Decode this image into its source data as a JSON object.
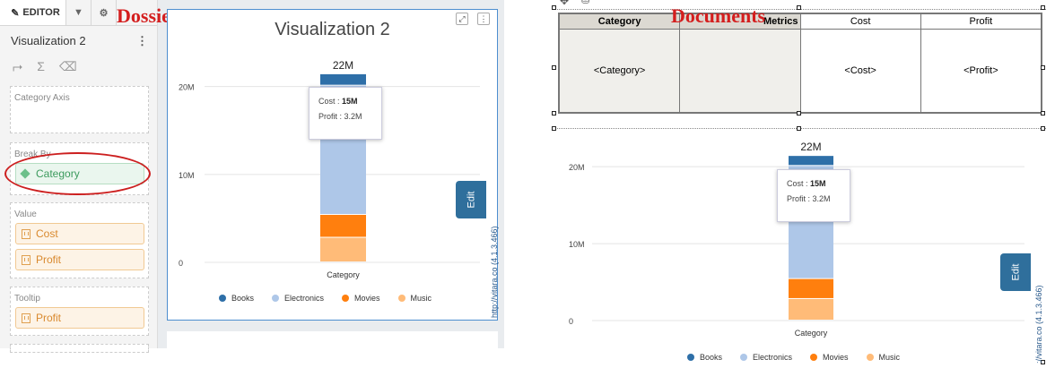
{
  "labels": {
    "dossiers": "Dossiers",
    "documents": "Documents"
  },
  "editor": {
    "tab_editor": "EDITOR",
    "viz_name": "Visualization 2",
    "zones": [
      {
        "title": "Category Axis",
        "items": []
      },
      {
        "title": "Break By",
        "items": [
          "Category"
        ]
      },
      {
        "title": "Value",
        "items": [
          "Cost",
          "Profit"
        ]
      },
      {
        "title": "Tooltip",
        "items": [
          "Profit"
        ]
      }
    ]
  },
  "viz": {
    "title": "Visualization 2",
    "edit": "Edit",
    "link": "http://vitara.co (4.1.3.466)"
  },
  "document": {
    "headers": [
      "Category",
      "Metrics",
      "Cost",
      "Profit"
    ],
    "cells": [
      "<Category>",
      "",
      "<Cost>",
      "<Profit>"
    ],
    "edit": "Edit",
    "link": "://vitara.co (4.1.3.466)"
  },
  "chart_data": [
    {
      "type": "bar",
      "stacked": true,
      "categories": [
        "Category"
      ],
      "xlabel": "Category",
      "ylim": [
        0,
        22
      ],
      "yticks": [
        "0",
        "10M",
        "20M"
      ],
      "total_label": "22M",
      "series": [
        {
          "name": "Books",
          "values": [
            1.3
          ],
          "color": "#2e6fa8"
        },
        {
          "name": "Electronics",
          "values": [
            14.7
          ],
          "color": "#aec7e8"
        },
        {
          "name": "Movies",
          "values": [
            2.6
          ],
          "color": "#ff7f0e"
        },
        {
          "name": "Music",
          "values": [
            2.8
          ],
          "color": "#ffbb78"
        }
      ],
      "tooltip": {
        "cost_label": "Cost",
        "cost_value": "15M",
        "profit_label": "Profit",
        "profit_value": "3.2M"
      }
    }
  ]
}
